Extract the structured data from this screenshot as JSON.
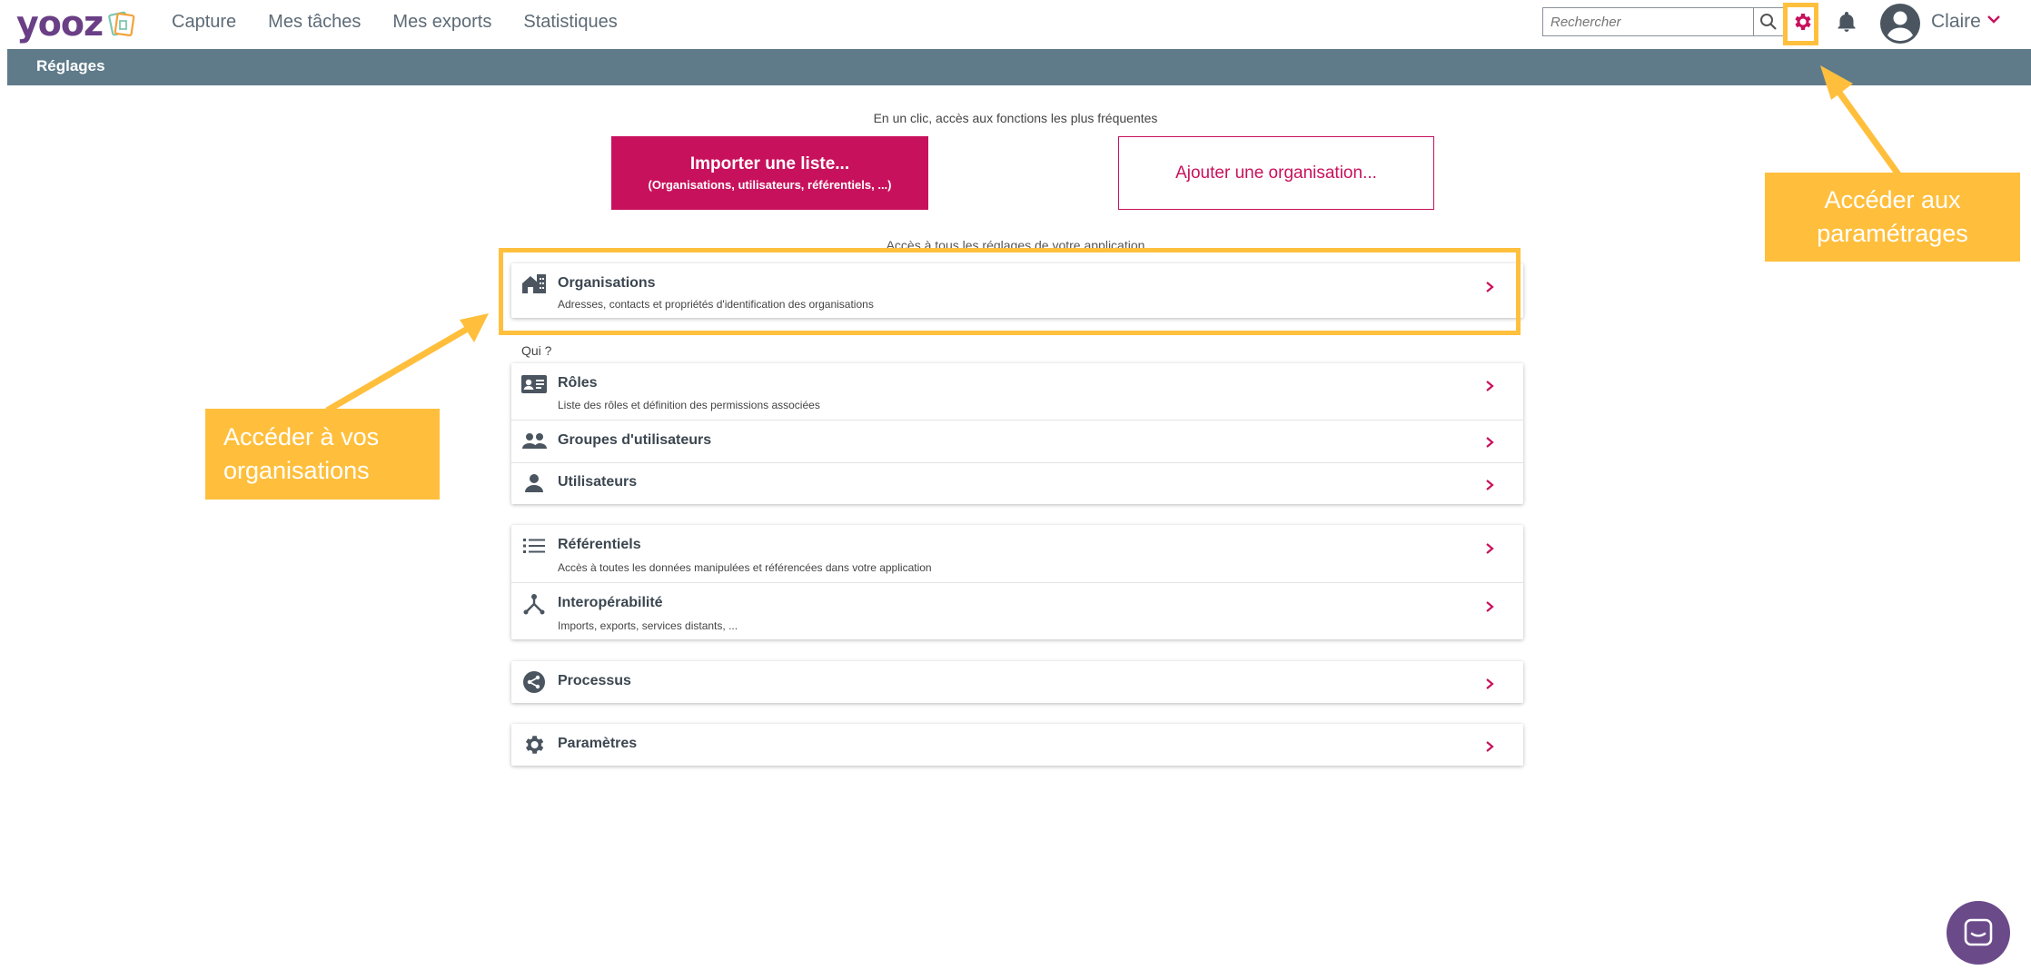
{
  "app": {
    "logo": "yooz"
  },
  "nav": {
    "items": [
      "Capture",
      "Mes tâches",
      "Mes exports",
      "Statistiques"
    ]
  },
  "search": {
    "placeholder": "Rechercher"
  },
  "user": {
    "name": "Claire"
  },
  "subheader": {
    "title": "Réglages"
  },
  "quick": {
    "caption": "En un clic, accès aux fonctions les plus fréquentes",
    "import_title": "Importer une liste...",
    "import_subtitle": "(Organisations, utilisateurs, référentiels, ...)",
    "add_org": "Ajouter une organisation..."
  },
  "settings_caption": "Accès à tous les réglages de votre application",
  "organisations": {
    "title": "Organisations",
    "desc": "Adresses, contacts et propriétés d'identification des organisations"
  },
  "qui_label": "Qui ?",
  "qui_rows": [
    {
      "title": "Rôles",
      "desc": "Liste des rôles et définition des permissions associées"
    },
    {
      "title": "Groupes d'utilisateurs"
    },
    {
      "title": "Utilisateurs"
    }
  ],
  "data_rows": [
    {
      "title": "Référentiels",
      "desc": "Accès à toutes les données manipulées et référencées dans votre application"
    },
    {
      "title": "Interopérabilité",
      "desc": "Imports, exports, services distants, ..."
    }
  ],
  "processus": {
    "title": "Processus"
  },
  "parametres": {
    "title": "Paramètres"
  },
  "annotations": {
    "settings_callout": "Accéder aux paramétrages",
    "orgs_callout": "Accéder à vos organisations"
  },
  "colors": {
    "accent": "#c8115c",
    "subheader": "#5f7b8a",
    "annotation": "#ffbf3c",
    "brand": "#6b3f86"
  }
}
